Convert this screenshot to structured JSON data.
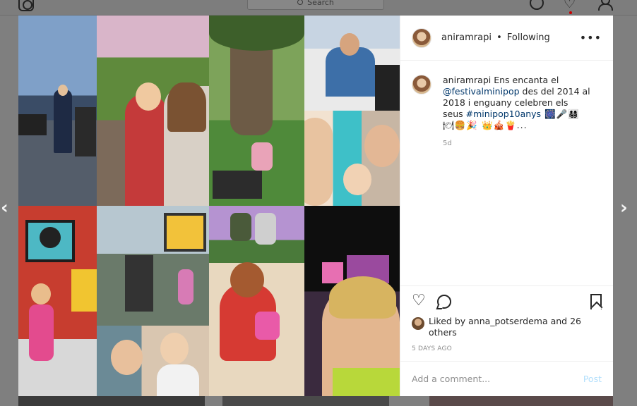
{
  "background": {
    "search_placeholder": "Search",
    "logo_icon": "instagram-logo-icon",
    "nav_icons": [
      "compass-icon",
      "heart-icon",
      "profile-icon"
    ]
  },
  "carousel": {
    "prev_label": "‹",
    "next_label": "›"
  },
  "post": {
    "header": {
      "username": "aniramrapi",
      "separator": "•",
      "follow_status": "Following",
      "more_label": "•••"
    },
    "caption": {
      "username": "aniramrapi",
      "text_1": " Ens encanta el ",
      "mention": "@festivalminipop",
      "text_2": " des del 2014 al 2018 i enguany celebren els seus ",
      "hashtag": "#minipop10anys",
      "emojis": " 🎆🎤👨‍👩‍👧‍👦🍽🍔🎉 👑🎪🍟...",
      "age": "5d"
    },
    "likes": {
      "prefix": "Liked by ",
      "user": "anna_potserdema",
      "middle": " and ",
      "others": "26 others"
    },
    "timestamp": "5 DAYS AGO",
    "comment": {
      "placeholder": "Add a comment...",
      "post_label": "Post"
    }
  },
  "colors": {
    "overlay": "#7f7f7f",
    "link": "#00376b",
    "post_disabled": "#b2dffc",
    "meta_grey": "#8e8e8e"
  }
}
